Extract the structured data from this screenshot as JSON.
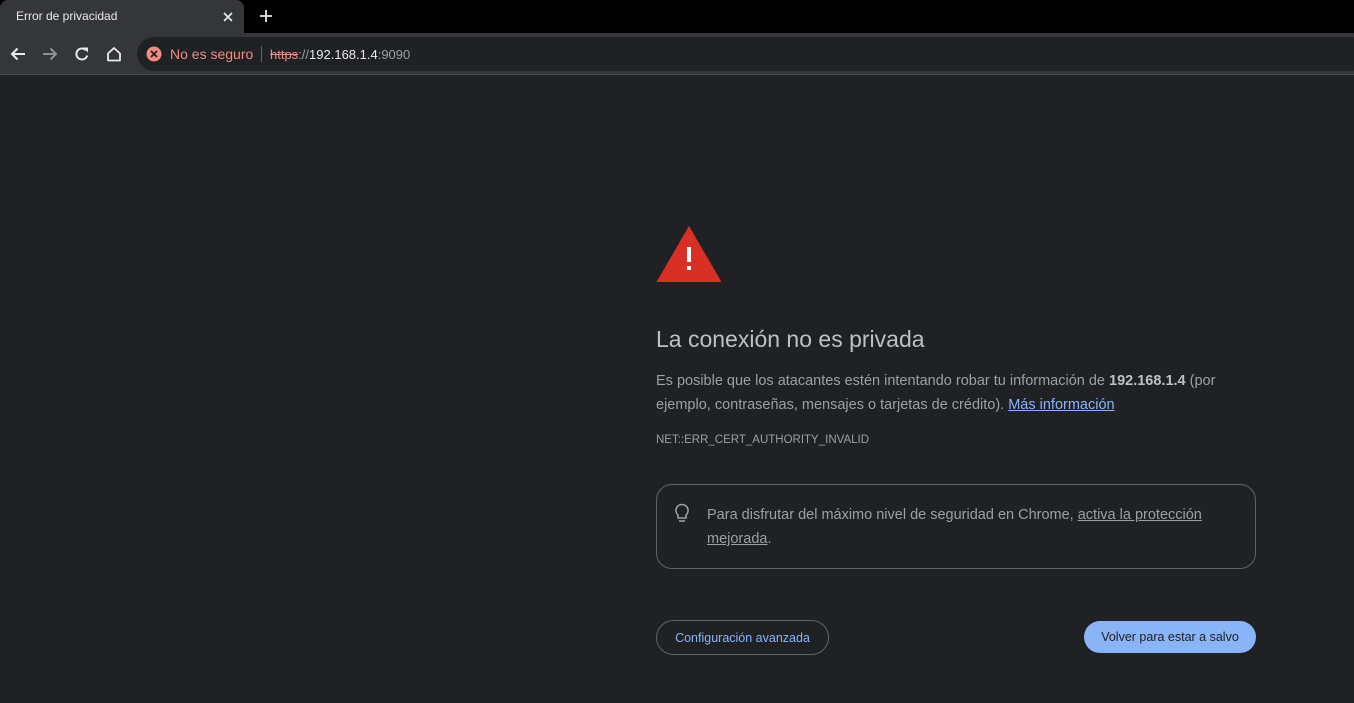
{
  "tab": {
    "title": "Error de privacidad",
    "close_icon": "close-icon",
    "new_tab_icon": "plus-icon"
  },
  "toolbar": {
    "back_icon": "arrow-left-icon",
    "forward_icon": "arrow-right-icon",
    "reload_icon": "reload-icon",
    "home_icon": "home-icon",
    "security_label": "No es seguro",
    "url": {
      "scheme": "https",
      "separator": "://",
      "host": "192.168.1.4",
      "port": ":9090"
    }
  },
  "content": {
    "heading": "La conexión no es privada",
    "body_prefix": "Es posible que los atacantes estén intentando robar tu información de ",
    "body_host": "192.168.1.4",
    "body_suffix": " (por ejemplo, contraseñas, mensajes o tarjetas de crédito). ",
    "learn_more": "Más información",
    "error_code": "NET::ERR_CERT_AUTHORITY_INVALID",
    "tip": {
      "text_prefix": "Para disfrutar del máximo nivel de seguridad en Chrome, ",
      "link": "activa la protección mejorada",
      "text_suffix": "."
    },
    "advanced_button": "Configuración avanzada",
    "back_button": "Volver para estar a salvo"
  },
  "colors": {
    "page_bg": "#202124",
    "accent": "#8ab4f8",
    "warning_red": "#f28b82",
    "warning_triangle": "#d93025"
  }
}
